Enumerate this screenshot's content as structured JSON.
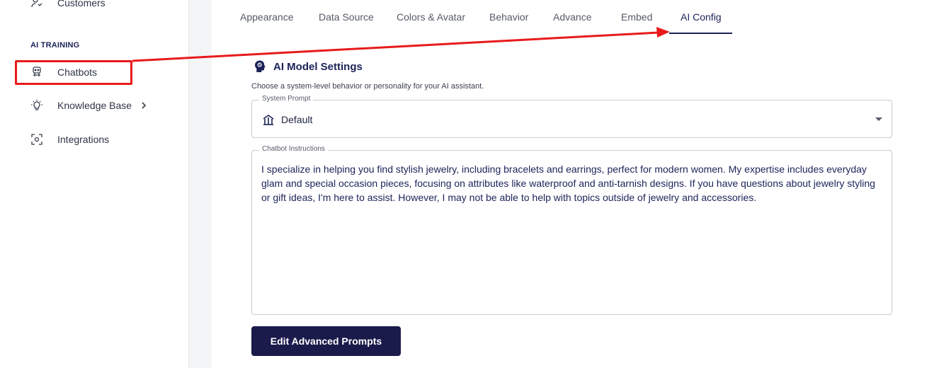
{
  "sidebar": {
    "items": [
      {
        "label": "Customers",
        "icon": "customers-icon"
      },
      {
        "label": "Chatbots",
        "icon": "chatbot-icon"
      },
      {
        "label": "Knowledge Base",
        "icon": "lightbulb-icon",
        "chevron": "chevron-right-icon"
      },
      {
        "label": "Integrations",
        "icon": "integrations-icon"
      }
    ],
    "section_label": "AI TRAINING"
  },
  "tabs": [
    "Appearance",
    "Data Source",
    "Colors & Avatar",
    "Behavior",
    "Advance",
    "Embed",
    "AI Config"
  ],
  "active_tab": "AI Config",
  "ai_settings": {
    "title": "AI Model Settings",
    "title_icon": "brain-icon",
    "description": "Choose a system-level behavior or personality for your AI assistant.",
    "system_prompt": {
      "label": "System Prompt",
      "value": "Default",
      "icon": "default-prompt-icon"
    },
    "instructions": {
      "label": "Chatbot Instructions",
      "value": "I specialize in helping you find stylish jewelry, including bracelets and earrings, perfect for modern women. My expertise includes everyday glam and special occasion pieces, focusing on attributes like waterproof and anti-tarnish designs. If you have questions about jewelry styling or gift ideas, I'm here to assist. However, I may not be able to help with topics outside of jewelry and accessories."
    },
    "advanced_button": "Edit Advanced Prompts"
  },
  "colors": {
    "brand_navy": "#1c2358",
    "button_bg": "#1a1a4b",
    "annotation_red": "#e81b1b"
  }
}
